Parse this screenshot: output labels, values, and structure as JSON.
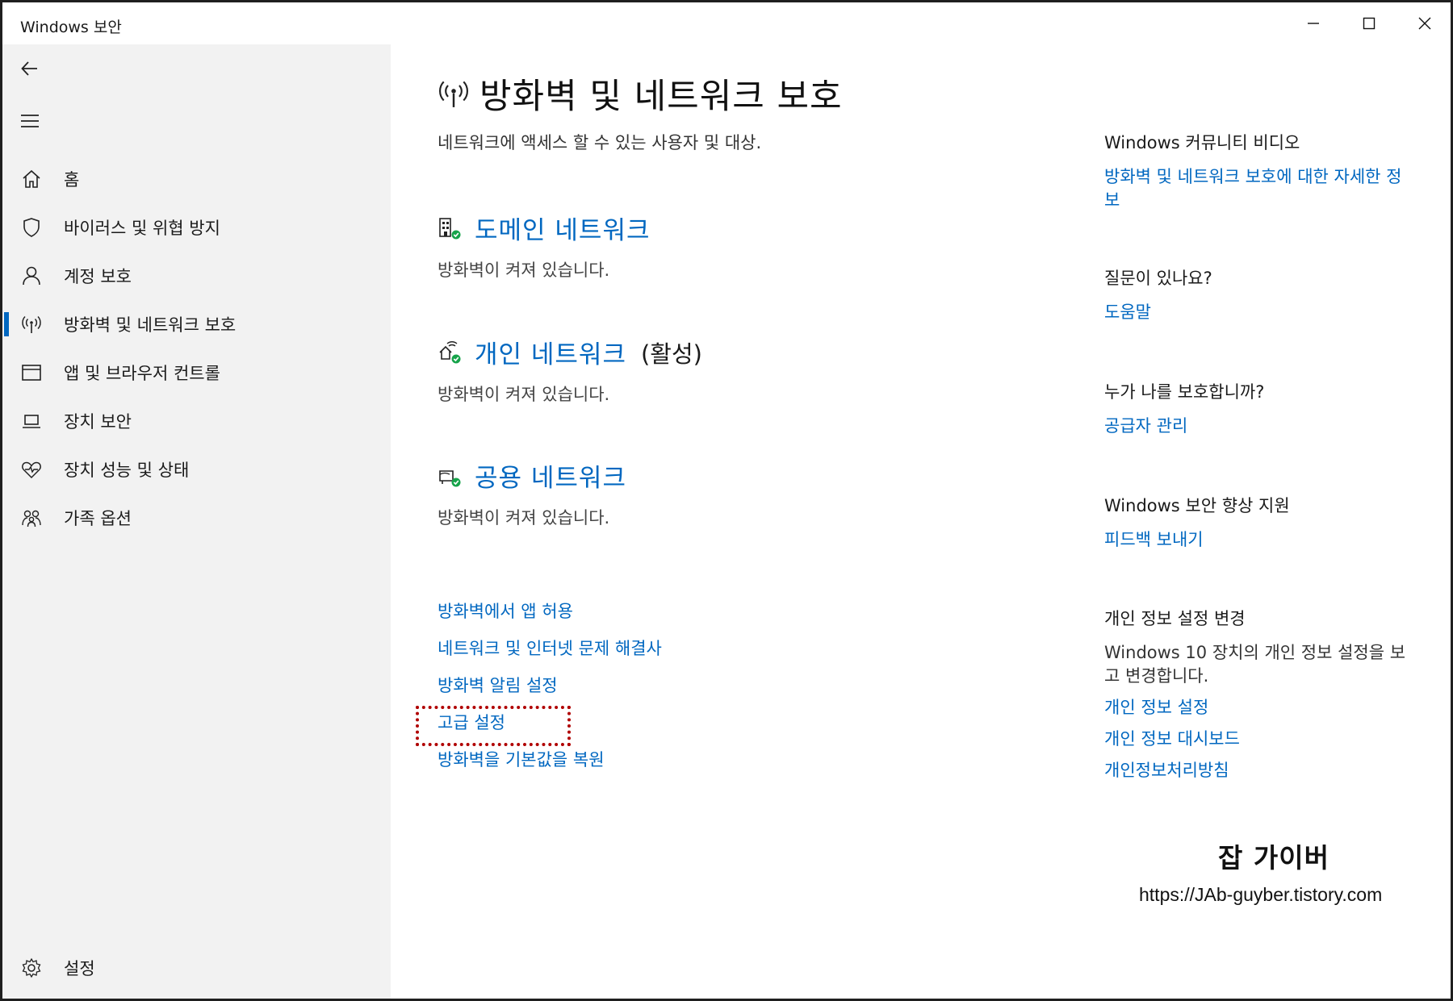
{
  "window": {
    "title": "Windows 보안",
    "controls": [
      "minimize-icon",
      "maximize-icon",
      "close-icon"
    ]
  },
  "sidebar": {
    "back_icon": "back-arrow-icon",
    "menu_icon": "hamburger-icon",
    "items": [
      {
        "label": "홈",
        "icon": "home-icon",
        "active": false
      },
      {
        "label": "바이러스 및 위협 방지",
        "icon": "shield-icon",
        "active": false
      },
      {
        "label": "계정 보호",
        "icon": "person-icon",
        "active": false
      },
      {
        "label": "방화벽 및 네트워크 보호",
        "icon": "antenna-icon",
        "active": true
      },
      {
        "label": "앱 및 브라우저 컨트롤",
        "icon": "browser-window-icon",
        "active": false
      },
      {
        "label": "장치 보안",
        "icon": "laptop-icon",
        "active": false
      },
      {
        "label": "장치 성능 및 상태",
        "icon": "heart-pulse-icon",
        "active": false
      },
      {
        "label": "가족 옵션",
        "icon": "family-icon",
        "active": false
      }
    ],
    "settings": {
      "label": "설정",
      "icon": "gear-icon"
    }
  },
  "main": {
    "title": "방화벽 및 네트워크 보호",
    "subtitle": "네트워크에 액세스 할 수 있는 사용자 및 대상.",
    "networks": [
      {
        "title": "도메인 네트워크",
        "extra": "",
        "status": "방화벽이 켜져 있습니다.",
        "icon": "domain-network-icon"
      },
      {
        "title": "개인 네트워크",
        "extra": "(활성)",
        "status": "방화벽이 켜져 있습니다.",
        "icon": "private-network-icon"
      },
      {
        "title": "공용 네트워크",
        "extra": "",
        "status": "방화벽이 켜져 있습니다.",
        "icon": "public-network-icon"
      }
    ],
    "links": [
      "방화벽에서 앱 허용",
      "네트워크 및 인터넷 문제 해결사",
      "방화벽 알림 설정",
      "고급 설정",
      "방화벽을 기본값을 복원"
    ]
  },
  "aside": {
    "community": {
      "heading": "Windows 커뮤니티 비디오",
      "link": "방화벽 및 네트워크 보호에 대한 자세한 정보"
    },
    "question": {
      "heading": "질문이 있나요?",
      "link": "도움말"
    },
    "protector": {
      "heading": "누가 나를 보호합니까?",
      "link": "공급자 관리"
    },
    "improve": {
      "heading": "Windows 보안 향상 지원",
      "link": "피드백 보내기"
    },
    "privacy": {
      "heading": "개인 정보 설정 변경",
      "text": "Windows 10 장치의 개인 정보 설정을 보고 변경합니다.",
      "links": [
        "개인 정보 설정",
        "개인 정보 대시보드",
        "개인정보처리방침"
      ]
    }
  },
  "watermark": {
    "title": "잡 가이버",
    "url": "https://JAb-guyber.tistory.com"
  },
  "colors": {
    "accent": "#0067c0",
    "sidebar_bg": "#f2f2f2",
    "ok_green": "#16a34a",
    "highlight": "#b00000"
  }
}
